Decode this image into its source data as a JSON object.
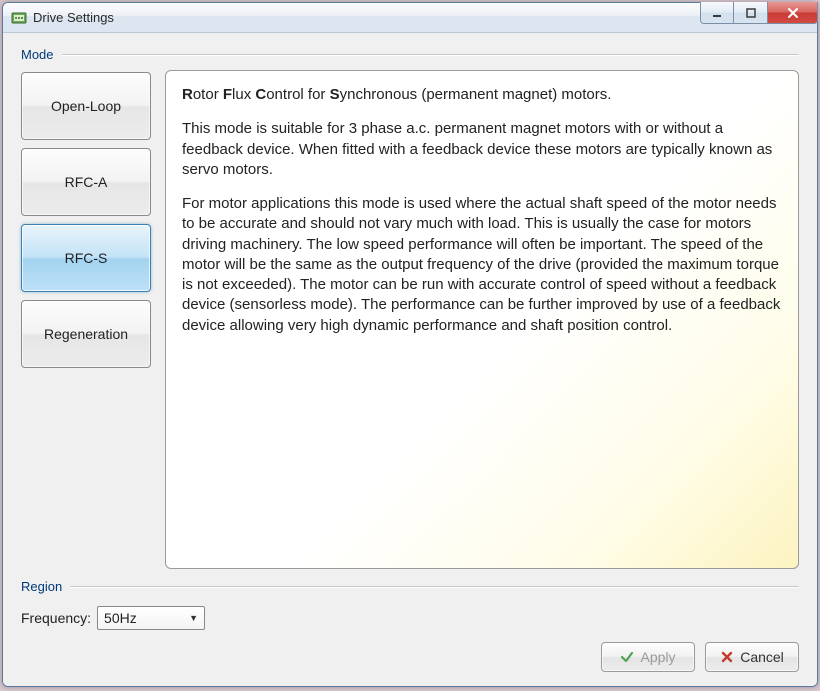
{
  "window": {
    "title": "Drive Settings"
  },
  "mode": {
    "group_label": "Mode",
    "buttons": [
      {
        "label": "Open-Loop"
      },
      {
        "label": "RFC-A"
      },
      {
        "label": "RFC-S"
      },
      {
        "label": "Regeneration"
      }
    ],
    "selected_index": 2,
    "description": {
      "heading_prefix_R": "R",
      "heading_mid1": "otor ",
      "heading_prefix_F": "F",
      "heading_mid2": "lux ",
      "heading_prefix_C": "C",
      "heading_mid3": "ontrol for ",
      "heading_prefix_S": "S",
      "heading_mid4": "ynchronous (permanent magnet) motors.",
      "para1": "This mode is suitable for 3 phase a.c. permanent magnet motors with or without a feedback device. When fitted with a feedback device these motors are typically known as servo motors.",
      "para2": "For motor applications this mode is used where the actual shaft speed of the motor needs to be accurate and should not vary much with load. This is usually the case for motors driving machinery. The low speed performance will often be important. The speed of the motor will be the same as the output frequency of the drive (provided the maximum torque is not exceeded). The motor can be run with accurate control of speed without a feedback device (sensorless mode). The performance can be further improved by use of a feedback device allowing very high dynamic performance and shaft position control."
    }
  },
  "region": {
    "group_label": "Region",
    "frequency_label": "Frequency:",
    "frequency_value": "50Hz"
  },
  "footer": {
    "apply_label": "Apply",
    "cancel_label": "Cancel"
  }
}
